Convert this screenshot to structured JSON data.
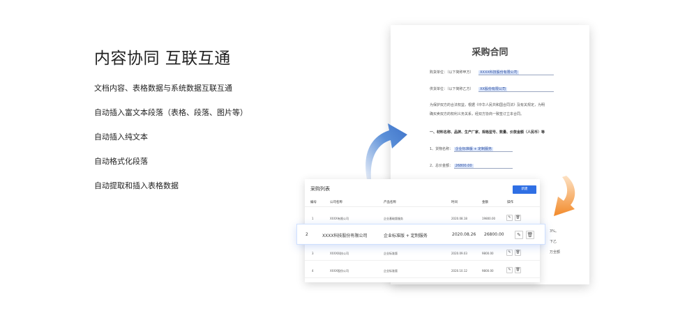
{
  "hero": {
    "title": "内容协同 互联互通",
    "features": [
      "文档内容、表格数据与系统数据互联互通",
      "自动插入富文本段落（表格、段落、图片等）",
      "自动插入纯文本",
      "自动格式化段落",
      "自动提取和插入表格数据"
    ]
  },
  "contract": {
    "title": "采购合同",
    "buyer_label": "购货单位：（以下简称甲方）",
    "buyer_value": "XXXX科技股份有限公司",
    "seller_label": "供货单位：（以下简称乙方）",
    "seller_value": "XX股份有限公司",
    "para1": "为保护双方的合法权益，根据《中华人民共和国合同法》及有关规定，为明",
    "para2": "确买卖双方的权利义务关系，经双方协商一致签订立本合同。",
    "section1": "一、材料名称、品牌、生产厂家、规格型号、数量、价款金额（人民币）等",
    "item1_label": "1、货物名称：",
    "item1_value": "企业标准版 + 定制服务",
    "item2_label": "2、总价金额：",
    "item2_value": "26800.00",
    "side1": "3%。",
    "side2": "下乙",
    "side3": "万全额"
  },
  "purchase_list": {
    "title": "采购列表",
    "new_button": "新建",
    "columns": [
      "编号",
      "公司名称",
      "产品名称",
      "时间",
      "金额",
      "操作"
    ],
    "rows": [
      {
        "id": "1",
        "company": "XXXX有限公司",
        "product": "企业基础版服务",
        "date": "2020.08.18",
        "amount": "19800.00"
      },
      {
        "id": "2",
        "company": "XXXX科技股份有限公司",
        "product": "企业标准版 + 定制服务",
        "date": "2020.08.26",
        "amount": "26800.00"
      },
      {
        "id": "3",
        "company": "XXXX科技公司",
        "product": "企业标准版",
        "date": "2020.09.03",
        "amount": "9800.00"
      },
      {
        "id": "4",
        "company": "XXXX股份公司",
        "product": "企业标准版",
        "date": "2020.10.12",
        "amount": "9800.00"
      }
    ],
    "edit_icon": "✎",
    "delete_icon": "🗑"
  },
  "colors": {
    "accent": "#2f6fe4",
    "arrow_blue": "#5a8fd8",
    "arrow_orange": "#f28a2a"
  }
}
